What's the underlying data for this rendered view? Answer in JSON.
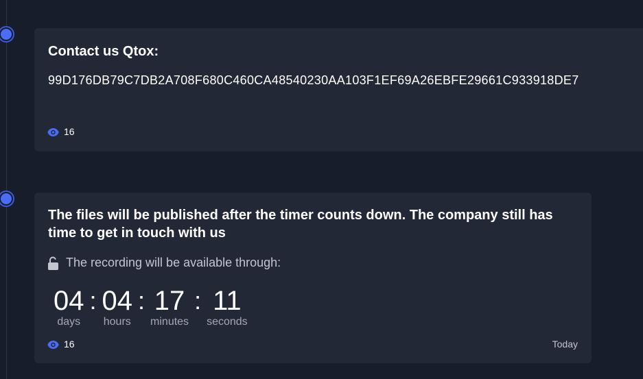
{
  "colors": {
    "background": "#181d2b",
    "card": "#232836",
    "accent": "#4a6cf7"
  },
  "posts": [
    {
      "title": "Contact us Qtox:",
      "body": "99D176DB79C7DB2A708F680C460CA48540230AA103F1EF69A26EBFE29661C933918DE7",
      "views": "16",
      "icon": "eye-icon"
    },
    {
      "title": "The files will be published after the timer counts down. The company still has time to get in touch with us",
      "recording_text": "The recording will be available through:",
      "recording_icon": "unlock-icon",
      "timer": {
        "days": "04",
        "hours": "04",
        "minutes": "17",
        "seconds": "11",
        "separator": ":",
        "days_label": "days",
        "hours_label": "hours",
        "minutes_label": "minutes",
        "seconds_label": "seconds"
      },
      "views": "16",
      "icon": "eye-icon",
      "date": "Today"
    }
  ]
}
